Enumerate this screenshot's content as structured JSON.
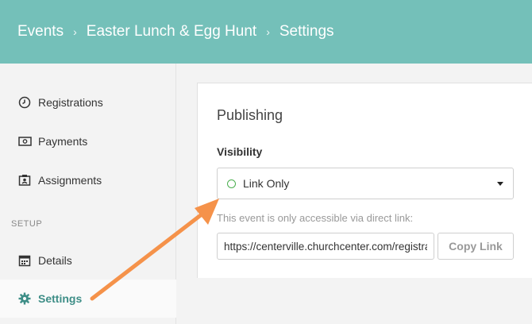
{
  "breadcrumb": {
    "items": [
      "Events",
      "Easter Lunch & Egg Hunt",
      "Settings"
    ],
    "separator": "›"
  },
  "sidebar": {
    "items": [
      {
        "label": "Registrations",
        "icon": "clock-icon"
      },
      {
        "label": "Payments",
        "icon": "money-icon"
      },
      {
        "label": "Assignments",
        "icon": "assignments-icon"
      }
    ],
    "section_label": "SETUP",
    "setup_items": [
      {
        "label": "Details",
        "icon": "calendar-icon"
      },
      {
        "label": "Settings",
        "icon": "gear-icon",
        "active": true
      }
    ]
  },
  "publishing": {
    "title": "Publishing",
    "visibility_label": "Visibility",
    "visibility_value": "Link Only",
    "help_text": "This event is only accessible via direct link:",
    "link_value": "https://centerville.churchcenter.com/registrations/events/",
    "copy_label": "Copy Link"
  },
  "colors": {
    "header": "#74c0b9",
    "accent": "#3e8e87",
    "arrow": "#f5924a",
    "status_dot": "#4caf50"
  }
}
